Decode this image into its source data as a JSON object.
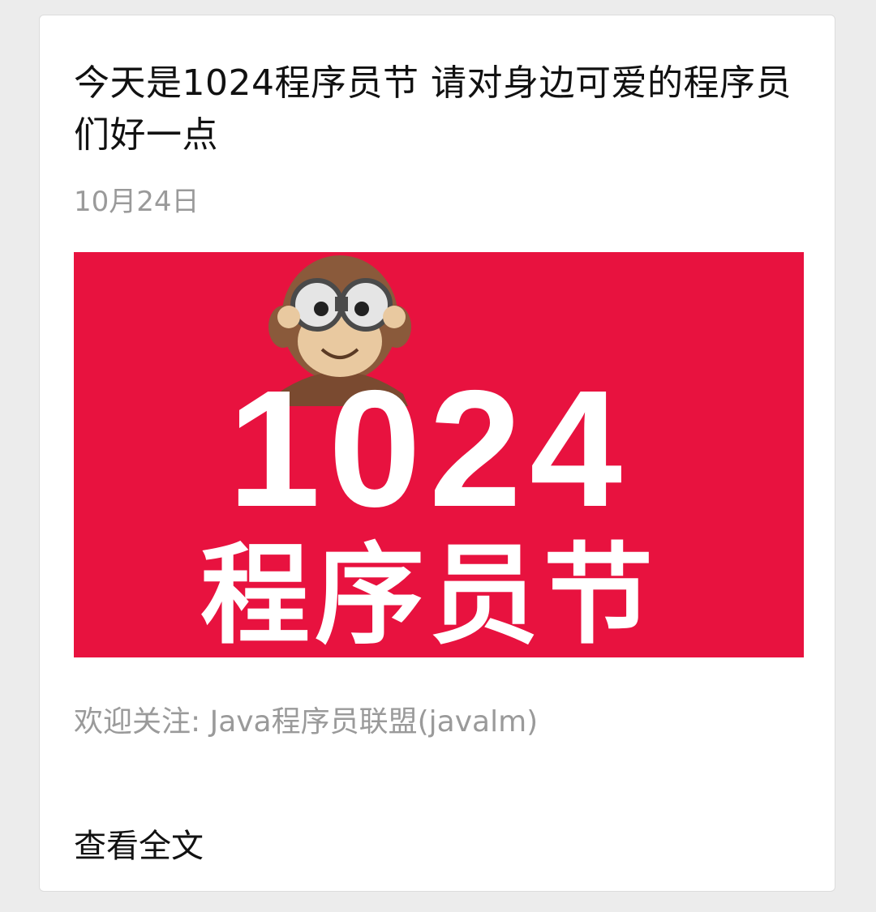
{
  "article": {
    "title": "今天是1024程序员节 请对身边可爱的程序员们好一点",
    "date": "10月24日",
    "caption": "欢迎关注: Java程序员联盟(javalm)",
    "read_more": "查看全文"
  },
  "banner": {
    "number_text": "1024",
    "subtitle_text": "程序员节",
    "background_color": "#e8123f",
    "mascot_icon": "monkey-with-binoculars-icon"
  }
}
